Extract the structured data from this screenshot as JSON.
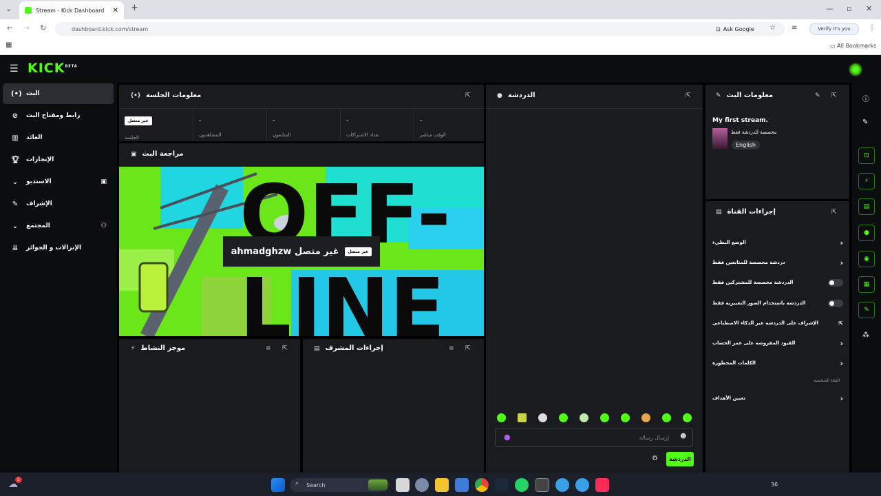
{
  "browser": {
    "tab_title": "Stream - Kick Dashboard",
    "url": "dashboard.kick.com/stream",
    "ask_google": "Ask Google",
    "verify": "Verify it's you",
    "all_bookmarks": "All Bookmarks"
  },
  "header": {
    "logo": "KICK",
    "logo_tag": "BETA"
  },
  "sidebar": {
    "items": [
      {
        "label": "البث",
        "icon": "broadcast-icon"
      },
      {
        "label": "رابط ومفتاح البث",
        "icon": "link-icon"
      },
      {
        "label": "العائد",
        "icon": "chart-icon"
      },
      {
        "label": "الإنجازات",
        "icon": "trophy-icon"
      },
      {
        "label": "الاستديو",
        "icon": "chevron-down-icon"
      },
      {
        "label": "الإشراف",
        "icon": "wrench-icon"
      },
      {
        "label": "المجتمع",
        "icon": "chevron-down-icon"
      },
      {
        "label": "الإنزالات و الجوائز",
        "icon": "drops-icon"
      }
    ]
  },
  "session": {
    "title": "معلومات الجلسة",
    "status_badge": "غير متصل",
    "session_label": "الجلسة",
    "stats": [
      {
        "value": "-",
        "label": "المشاهدون"
      },
      {
        "value": "-",
        "label": "المتابعون"
      },
      {
        "value": "-",
        "label": "تعداد الاشتراكات"
      },
      {
        "value": "-",
        "label": "الوقت مباشر"
      }
    ]
  },
  "preview": {
    "title": "مراجعة البث",
    "offline_badge": "غير متصل",
    "offline_text": "ahmadghzw غير متصل",
    "art_text_1": "OFF-",
    "art_text_2": "LINE"
  },
  "activity": {
    "title": "موجز النشاط"
  },
  "mod_actions": {
    "title": "إجراءات المشرف"
  },
  "chat": {
    "title": "الدردشة",
    "placeholder": "إرسال رسالة",
    "send_label": "الدردشة"
  },
  "stream_info": {
    "title": "معلومات البث",
    "stream_title": "My first stream.",
    "category": "مخصصة للدردشة فقط",
    "language": "English"
  },
  "channel_actions": {
    "title": "إجراءات القناة",
    "rows": [
      {
        "label": "الوضع البطيء",
        "control": "chevron"
      },
      {
        "label": "دردشة مخصصة للمتابعين فقط",
        "control": "chevron"
      },
      {
        "label": "الدردشة مخصصة للمشتركين فقط",
        "control": "toggle"
      },
      {
        "label": "الدردشة باستخدام الصور التعبيرية فقط",
        "control": "toggle"
      },
      {
        "label": "الإشراف على الدردشة عبر الذكاء الاصطناعي",
        "control": "external"
      },
      {
        "label": "القيود المفروضة على عمر الحساب",
        "control": "chevron"
      },
      {
        "label": "الكلمات المحظورة",
        "control": "chevron"
      }
    ],
    "section_label": "القناة الشخصية",
    "goals_label": "تعيين الأهداف"
  },
  "taskbar": {
    "search": "Search",
    "notif_count": "2",
    "battery": "36"
  },
  "colors": {
    "brand": "#53fc18",
    "panel": "#191b1f",
    "bg": "#000000"
  }
}
